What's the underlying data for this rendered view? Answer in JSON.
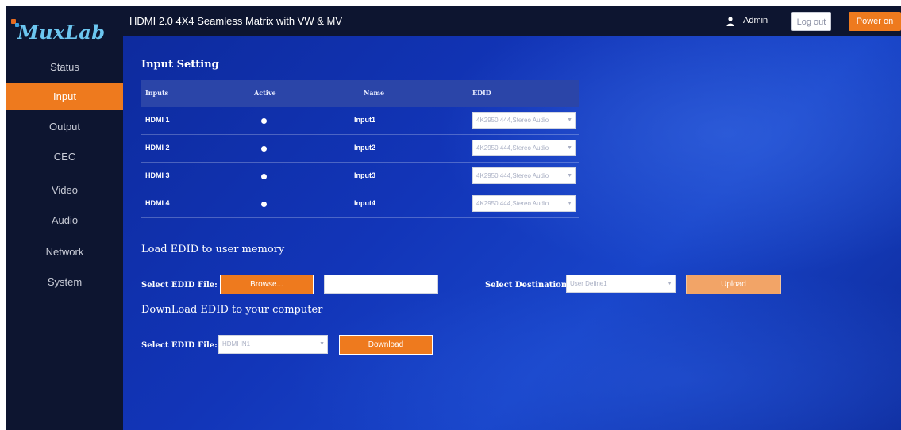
{
  "brand": {
    "logo_text": "MuxLab"
  },
  "header": {
    "title": "HDMI 2.0 4X4 Seamless Matrix with VW & MV",
    "user": "Admin",
    "logout_label": "Log out",
    "power_label": "Power on"
  },
  "sidebar": {
    "items": [
      {
        "label": "Status",
        "active": false
      },
      {
        "label": "Input",
        "active": true
      },
      {
        "label": "Output",
        "active": false
      },
      {
        "label": "CEC",
        "active": false
      },
      {
        "label": "Video",
        "active": false
      },
      {
        "label": "Audio",
        "active": false
      },
      {
        "label": "Network",
        "active": false
      },
      {
        "label": "System",
        "active": false
      }
    ]
  },
  "input_setting": {
    "title": "Input Setting",
    "columns": [
      "Inputs",
      "Active",
      "Name",
      "EDID"
    ],
    "rows": [
      {
        "input": "HDMI 1",
        "active": true,
        "name": "Input1",
        "edid": "4K2950 444,Stereo Audio"
      },
      {
        "input": "HDMI 2",
        "active": true,
        "name": "Input2",
        "edid": "4K2950 444,Stereo Audio"
      },
      {
        "input": "HDMI 3",
        "active": true,
        "name": "Input3",
        "edid": "4K2950 444,Stereo Audio"
      },
      {
        "input": "HDMI 4",
        "active": true,
        "name": "Input4",
        "edid": "4K2950 444,Stereo Audio"
      }
    ]
  },
  "load_edid": {
    "title": "Load EDID to user memory",
    "file_label": "Select EDID File:",
    "browse_label": "Browse...",
    "file_value": "",
    "destination_label": "Select Destination:",
    "destination_value": "User Define1",
    "upload_label": "Upload"
  },
  "download_edid": {
    "title": "DownLoad EDID to your computer",
    "file_label": "Select EDID File:",
    "file_value": "HDMI IN1",
    "download_label": "Download"
  },
  "colors": {
    "accent": "#ee7a1e",
    "sidebar_bg": "#0d1530",
    "main_bg": "#1235b8"
  },
  "icons": {
    "user": "user-icon",
    "caret": "chevron-down-icon"
  }
}
